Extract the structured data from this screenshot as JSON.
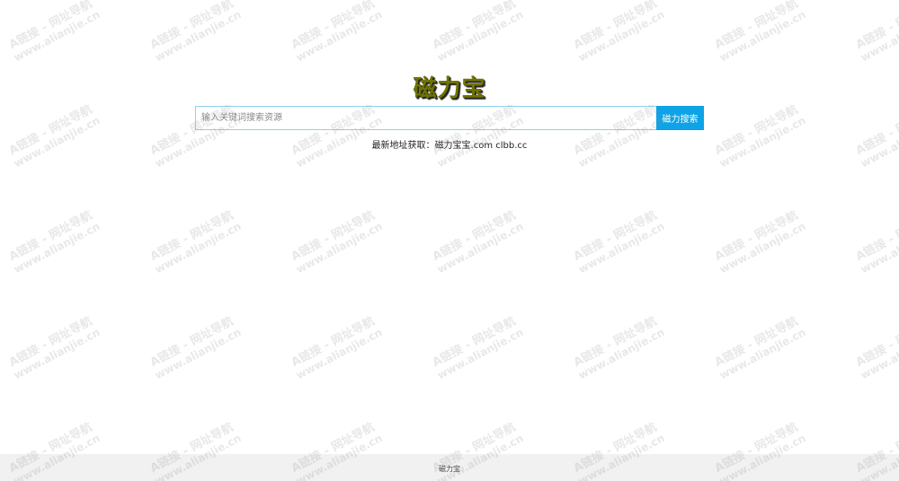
{
  "site": {
    "logo": "磁力宝"
  },
  "search": {
    "placeholder": "输入关键词搜索资源",
    "value": "",
    "button_label": "磁力搜索"
  },
  "notice": {
    "label": "最新地址获取：",
    "addresses": "磁力宝宝.com clbb.cc"
  },
  "footer": {
    "text": "磁力宝"
  },
  "watermark": {
    "line1": "A链接 - 网址导航",
    "line2": "www.alianjie.cn"
  },
  "colors": {
    "logo": "#6f7300",
    "button": "#0ea3e6",
    "input_border": "#8fd0f1",
    "footer_bg": "#f1f1f1"
  }
}
